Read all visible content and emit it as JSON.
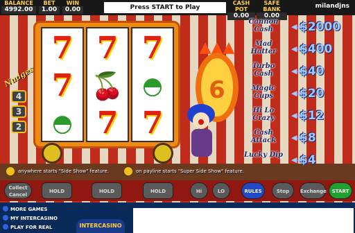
{
  "topbar": {
    "balance_label": "BALANCE",
    "balance_value": "4992.00",
    "bet_label": "BET",
    "bet_value": "1.00",
    "win_label": "WIN",
    "win_value": "0.00",
    "message": "Press START to Play",
    "cashpot_label": "CASH POT",
    "cashpot_value": "0.00",
    "safebank_label": "SAFE BANK",
    "safebank_value": "0.00",
    "username": "milandjns"
  },
  "nudges": {
    "title": "Nudges",
    "values": [
      "4",
      "3",
      "2"
    ]
  },
  "reels": [
    [
      "7",
      "7",
      "melon"
    ],
    [
      "7",
      "cherry",
      "7"
    ],
    [
      "7",
      "melon",
      "7"
    ]
  ],
  "ring_number": "6",
  "paytable": [
    {
      "name": "Cannon Cash",
      "prize": "$2000"
    },
    {
      "name": "Mad Hatter",
      "prize": "$400"
    },
    {
      "name": "Turbo Cash",
      "prize": "$40"
    },
    {
      "name": "Magic Cups",
      "prize": "$20"
    },
    {
      "name": "Hi Lo Crazy",
      "prize": "$12"
    },
    {
      "name": "Cash Attack",
      "prize": "$8"
    },
    {
      "name": "Lucky Dip",
      "prize": "$4"
    }
  ],
  "feature": {
    "left_text": "anywhere starts \"Side Show\" feature.",
    "right_text": "on payline starts \"Super Side Show\" feature."
  },
  "buttons": {
    "collect": "Collect Cancel",
    "hold1": "HOLD NUDGE",
    "hold2": "HOLD NUDGE",
    "hold3": "HOLD NUDGE",
    "hi": "Hi",
    "lo": "LO",
    "rules": "RULES",
    "stop": "Stop",
    "exchange": "Exchange",
    "start": "START"
  },
  "links": {
    "more_games": "MORE GAMES",
    "my_intercasino": "MY INTERCASINO",
    "play_for_real": "PLAY FOR REAL"
  },
  "logo_text": "INTERCASINO"
}
